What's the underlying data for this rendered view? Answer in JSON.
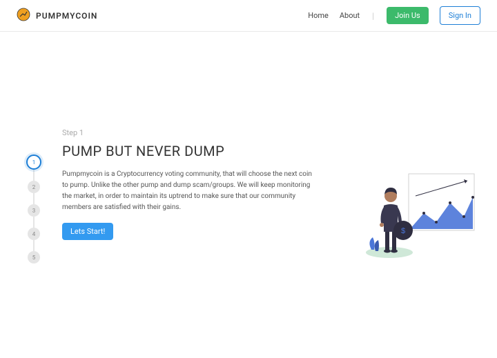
{
  "header": {
    "brand": "PUMPMYCOIN",
    "nav": {
      "home": "Home",
      "about": "About",
      "join": "Join Us",
      "signin": "Sign In"
    }
  },
  "stepper": {
    "steps": [
      "1",
      "2",
      "3",
      "4",
      "5"
    ],
    "active_index": 0
  },
  "main": {
    "step_label": "Step 1",
    "title": "PUMP BUT NEVER DUMP",
    "body": "Pumpmycoin is a Cryptocurrency voting community, that will choose the next coin to pump. Unlike the other pump and dump scam/groups. We will keep monitoring the market, in order to maintain its uptrend to make sure that our community members are satisfied with their gains.",
    "cta": "Lets Start!"
  },
  "colors": {
    "primary": "#339af0",
    "success": "#3cba6b",
    "accent": "#1c7ed6"
  }
}
